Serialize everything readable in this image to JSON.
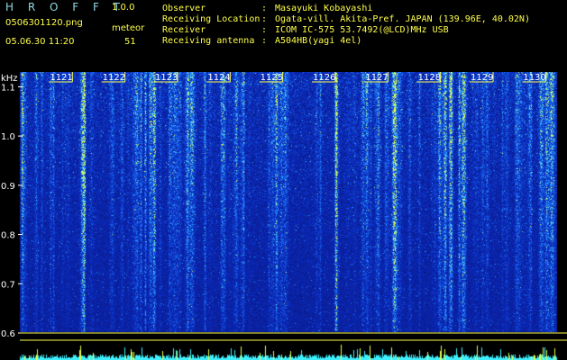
{
  "header": {
    "app_title": "H R O F F T",
    "app_version": "1.0.0",
    "filename": "0506301120.png",
    "datetime": "05.06.30 11:20",
    "meteor_label": "meteor",
    "meteor_count": "51"
  },
  "station_info": [
    {
      "label": "Observer",
      "value": "Masayuki Kobayashi"
    },
    {
      "label": "Receiving Location",
      "value": "Ogata-vill. Akita-Pref. JAPAN (139.96E, 40.02N)"
    },
    {
      "label": "Receiver",
      "value": "ICOM IC-575 53.7492(@LCD)MHz USB"
    },
    {
      "label": "Receiving antenna",
      "value": "A504HB(yagi 4el)"
    }
  ],
  "colon": ":",
  "chart_data": {
    "type": "heatmap",
    "ylabel": "kHz",
    "y_ticks": [
      "1.1",
      "1.0",
      "0.9",
      "0.8",
      "0.7",
      "0.6"
    ],
    "y_tick_values": [
      1.1,
      1.0,
      0.9,
      0.8,
      0.7,
      0.6
    ],
    "ylim": [
      0.6,
      1.13
    ],
    "x_ticks": [
      "1121",
      "1122",
      "1123",
      "1124",
      "1125",
      "1126",
      "1127",
      "1128",
      "1129",
      "1130"
    ],
    "x_tick_values": [
      1121,
      1122,
      1123,
      1124,
      1125,
      1126,
      1127,
      1128,
      1129,
      1130
    ],
    "xlim": [
      1120,
      1130.2
    ],
    "colors": {
      "background": "#0a1a8a",
      "low": "#0b2bbf",
      "mid": "#1f7fff",
      "high": "#4fe0ff",
      "peak": "#dfff4a",
      "axis": "#ffff4a",
      "tick_box": "#ffff4a",
      "bottom_trace": "#3ef0ff"
    }
  }
}
